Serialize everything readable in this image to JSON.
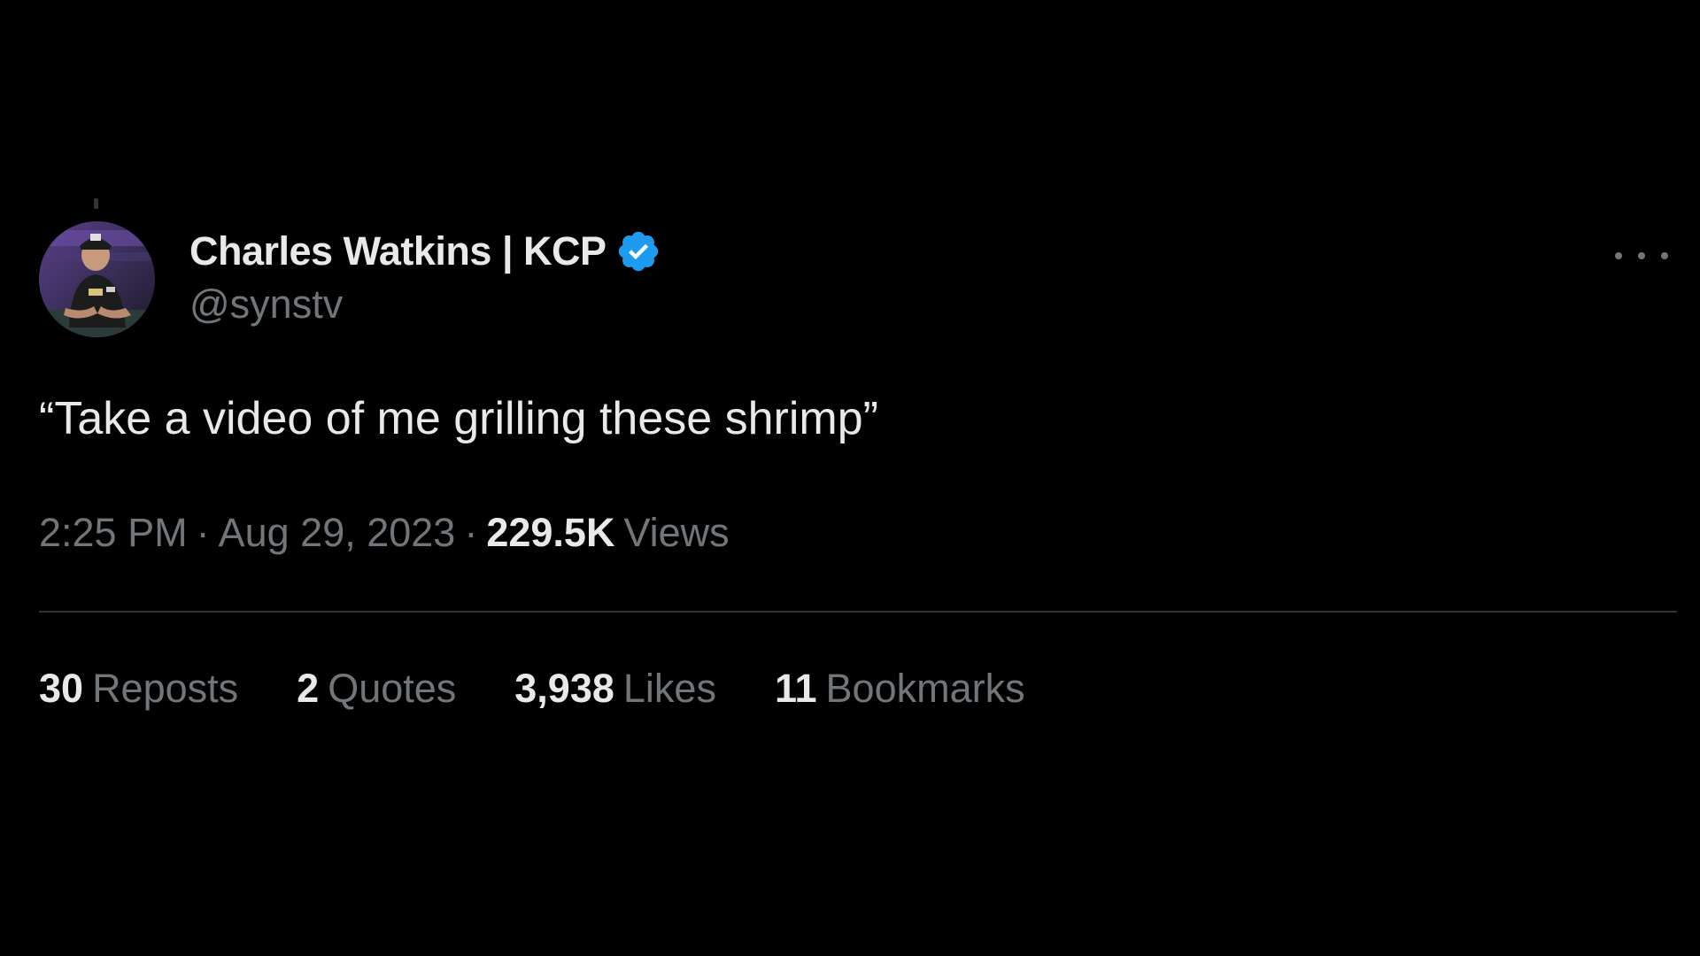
{
  "tweet": {
    "author": {
      "display_name": "Charles Watkins | KCP",
      "handle": "@synstv",
      "verified": true,
      "verified_color": "#1d9bf0",
      "avatar_icon": "profile-photo"
    },
    "more_icon": "more-horizontal-icon",
    "text": "“Take a video of me grilling these shrimp”",
    "time": "2:25 PM",
    "separator": "·",
    "date": "Aug 29, 2023",
    "views_count": "229.5K",
    "views_label": "Views"
  },
  "stats": [
    {
      "count": "30",
      "label": "Reposts"
    },
    {
      "count": "2",
      "label": "Quotes"
    },
    {
      "count": "3,938",
      "label": "Likes"
    },
    {
      "count": "11",
      "label": "Bookmarks"
    }
  ],
  "colors": {
    "background": "#000000",
    "primary_text": "#e7e9ea",
    "secondary_text": "#71767b",
    "divider": "#2f3336",
    "accent": "#1d9bf0"
  }
}
